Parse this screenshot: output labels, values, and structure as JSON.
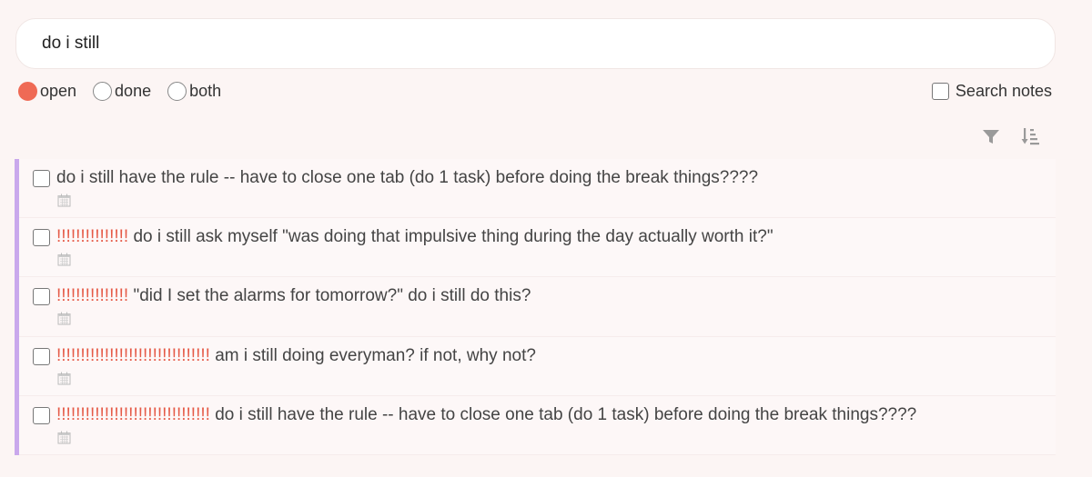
{
  "search": {
    "value": "do i still"
  },
  "filters": [
    {
      "label": "open",
      "checked": true
    },
    {
      "label": "done",
      "checked": false
    },
    {
      "label": "both",
      "checked": false
    }
  ],
  "search_notes": {
    "label": "Search notes",
    "checked": false
  },
  "toolbar": {
    "filter_icon": "filter-icon",
    "sort_icon": "sort-icon"
  },
  "tasks": [
    {
      "bangs": "",
      "text": "do i still have the rule -- have to close one tab (do 1 task) before doing the break things????"
    },
    {
      "bangs": "!!!!!!!!!!!!!!!",
      "text": " do i still ask myself \"was doing that impulsive thing during the day actually worth it?\""
    },
    {
      "bangs": "!!!!!!!!!!!!!!!",
      "text": " \"did I set the alarms for tomorrow?\" do i still do this?"
    },
    {
      "bangs": "!!!!!!!!!!!!!!!!!!!!!!!!!!!!!!!!",
      "text": " am i still doing everyman? if not, why not?"
    },
    {
      "bangs": "!!!!!!!!!!!!!!!!!!!!!!!!!!!!!!!!",
      "text": " do i still have the rule -- have to close one tab (do 1 task) before doing the break things????"
    }
  ],
  "colors": {
    "accent": "#ef6a55",
    "bangs": "#e55a47",
    "list_border": "#c9a8ec",
    "background": "#fcf5f4"
  }
}
